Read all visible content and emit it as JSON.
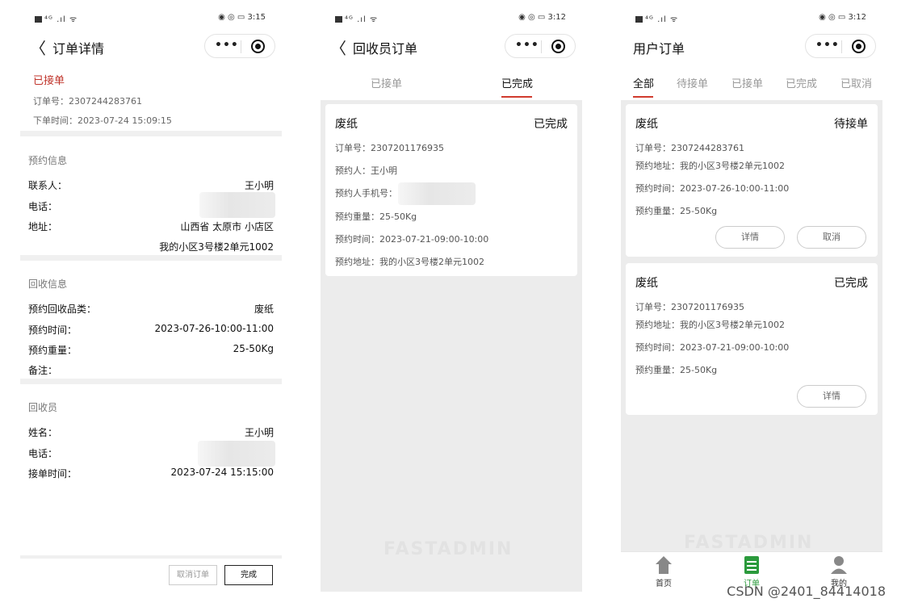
{
  "panel1": {
    "status_time": "3:15",
    "nav_title": "订单详情",
    "order_status": "已接单",
    "order_no": "订单号：2307244283761",
    "order_time": "下单时间：2023-07-24 15:09:15",
    "booking": {
      "title": "预约信息",
      "contact_label": "联系人：",
      "contact_value": "王小明",
      "phone_label": "电话：",
      "address_label": "地址：",
      "address_line1": "山西省 太原市 小店区",
      "address_line2": "我的小区3号楼2单元1002"
    },
    "recycle": {
      "title": "回收信息",
      "category_label": "预约回收品类：",
      "category_value": "废纸",
      "time_label": "预约时间：",
      "time_value": "2023-07-26-10:00-11:00",
      "weight_label": "预约重量：",
      "weight_value": "25-50Kg",
      "remark_label": "备注："
    },
    "collector": {
      "title": "回收员",
      "name_label": "姓名：",
      "name_value": "王小明",
      "phone_label": "电话：",
      "accept_label": "接单时间：",
      "accept_value": "2023-07-24 15:15:00"
    },
    "cancel_button": "取消订单",
    "done_button": "完成"
  },
  "panel2": {
    "status_time": "3:12",
    "nav_title": "回收员订单",
    "tabs": [
      "已接单",
      "已完成"
    ],
    "card": {
      "title": "废纸",
      "status": "已完成",
      "order_no": "订单号：2307201176935",
      "person": "预约人：王小明",
      "phone": "预约人手机号：",
      "weight": "预约重量：25-50Kg",
      "time": "预约时间：2023-07-21-09:00-10:00",
      "address": "预约地址：我的小区3号楼2单元1002"
    },
    "watermark": "FASTADMIN"
  },
  "panel3": {
    "status_time": "3:12",
    "nav_title": "用户订单",
    "tabs": [
      "全部",
      "待接单",
      "已接单",
      "已完成",
      "已取消"
    ],
    "card1": {
      "title": "废纸",
      "status": "待接单",
      "order_no": "订单号：2307244283761",
      "address": "预约地址：我的小区3号楼2单元1002",
      "time": "预约时间：2023-07-26-10:00-11:00",
      "weight": "预约重量：25-50Kg",
      "detail_button": "详情",
      "cancel_button": "取消"
    },
    "card2": {
      "title": "废纸",
      "status": "已完成",
      "order_no": "订单号：2307201176935",
      "address": "预约地址：我的小区3号楼2单元1002",
      "time": "预约时间：2023-07-21-09:00-10:00",
      "weight": "预约重量：25-50Kg",
      "detail_button": "详情"
    },
    "tabbar": [
      "首页",
      "订单",
      "我的"
    ],
    "watermark": "FASTADMIN"
  },
  "credit": "CSDN @2401_84414018",
  "colors": {
    "accent_red": "#d03b2e",
    "tab_green": "#2b9a3c"
  }
}
